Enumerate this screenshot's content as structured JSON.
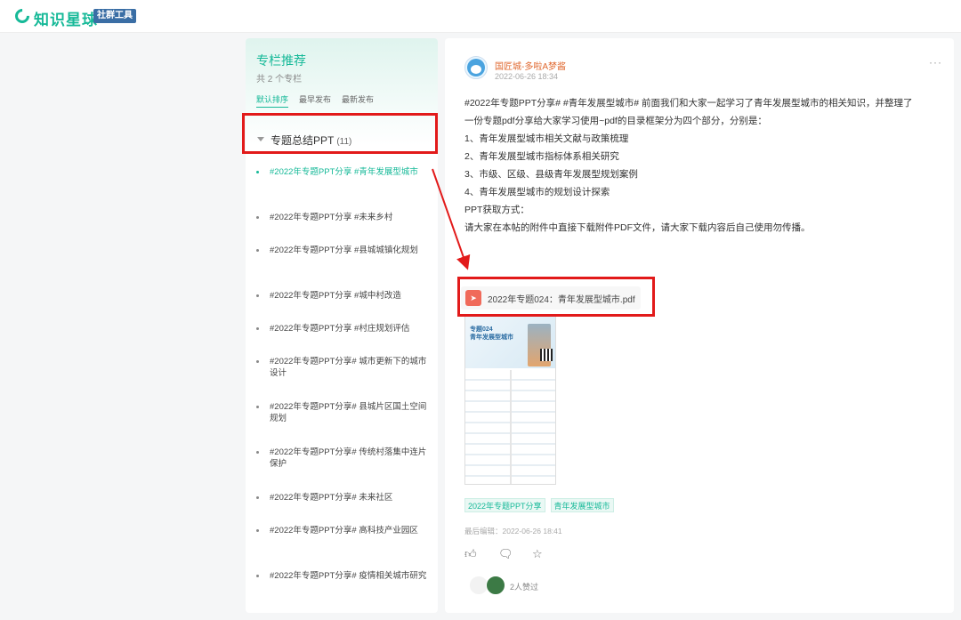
{
  "app": {
    "brand": "知识星球",
    "badge": "社群工具"
  },
  "column": {
    "title": "专栏推荐",
    "subtitle": "共 2 个专栏",
    "sort_tabs": [
      "默认排序",
      "最早发布",
      "最新发布"
    ],
    "group": {
      "label": "专题总结PPT",
      "count": "(11)"
    },
    "items": [
      "#2022年专题PPT分享 #青年发展型城市",
      "#2022年专题PPT分享 #未来乡村",
      "#2022年专题PPT分享 #县城城镇化规划",
      "#2022年专题PPT分享 #城中村改造",
      "#2022年专题PPT分享 #村庄规划评估",
      "#2022年专题PPT分享# 城市更新下的城市设计",
      "#2022年专题PPT分享# 县城片区国土空间规划",
      "#2022年专题PPT分享# 传统村落集中连片保护",
      "#2022年专题PPT分享# 未来社区",
      "#2022年专题PPT分享# 高科技产业园区",
      "#2022年专题PPT分享# 疫情相关城市研究"
    ]
  },
  "post": {
    "author": "国匠城-多啦A梦酱",
    "time": "2022-06-26 18:34",
    "more": "···",
    "content": [
      "#2022年专题PPT分享# #青年发展型城市# 前面我们和大家一起学习了青年发展型城市的相关知识，并整理了",
      "一份专题pdf分享给大家学习使用~pdf的目录框架分为四个部分，分别是：",
      "",
      "1、青年发展型城市相关文献与政策梳理",
      "2、青年发展型城市指标体系相关研究",
      "3、市级、区级、县级青年发展型规划案例",
      "4、青年发展型城市的规划设计探索",
      "",
      "PPT获取方式：",
      "请大家在本帖的附件中直接下载附件PDF文件，请大家下载内容后自己使用勿传播。"
    ],
    "attachment": "2022年专题024：青年发展型城市.pdf",
    "thumb_title": "专题024\n青年发展型城市",
    "tags": [
      "2022年专题PPT分享",
      "青年发展型城市"
    ],
    "edited": "最后编辑：2022-06-26 18:41",
    "like_text": "2人赞过"
  },
  "colors": {
    "accent": "#16b998",
    "author": "#e0682f",
    "annotation": "#e21a1a",
    "pdf": "#f06a5a"
  }
}
